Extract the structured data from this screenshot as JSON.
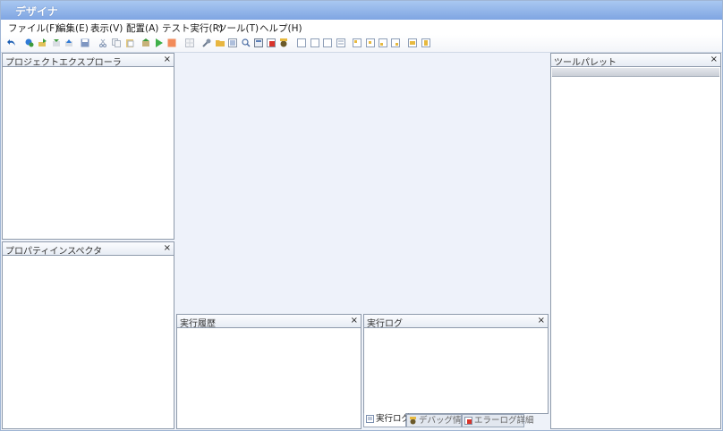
{
  "app": {
    "title": "デザイナ"
  },
  "menu": [
    {
      "label": "ファイル(F)"
    },
    {
      "label": "編集(E)"
    },
    {
      "label": "表示(V)"
    },
    {
      "label": "配置(A)"
    },
    {
      "label": "テスト実行(R)"
    },
    {
      "label": "ツール(T)"
    },
    {
      "label": "ヘルプ(H)"
    }
  ],
  "toolbar": {
    "icons": [
      "back-arrow-icon",
      "connect-icon",
      "refresh-icon",
      "import-icon",
      "export-icon",
      "save-icon",
      "cut-icon",
      "copy-icon",
      "paste-icon",
      "build-icon",
      "run-icon",
      "stop-icon",
      "grid-icon",
      "wrench-icon",
      "folder-icon",
      "list-icon",
      "search-icon",
      "properties-icon",
      "log-icon",
      "debug-icon",
      "align-left-icon",
      "align-center-icon",
      "align-right-icon",
      "align-justify-icon",
      "align-top-icon",
      "align-middle-icon",
      "align-bottom-icon",
      "distribute-icon",
      "size-width-icon",
      "size-height-icon"
    ]
  },
  "panels": {
    "project_explorer": {
      "title": "プロジェクトエクスプローラ",
      "close": "×"
    },
    "property_inspector": {
      "title": "プロパティインスペクタ",
      "close": "×"
    },
    "execution_history": {
      "title": "実行履歴",
      "close": "×"
    },
    "execution_log": {
      "title": "実行ログ",
      "close": "×"
    },
    "tool_palette": {
      "title": "ツールパレット",
      "close": "×"
    }
  },
  "log_tabs": [
    {
      "label": "実行ログ",
      "active": true
    },
    {
      "label": "デバッグ情報",
      "active": false
    },
    {
      "label": "エラーログ詳細",
      "active": false
    }
  ],
  "colors": {
    "title_gradient_top": "#a9c8f1",
    "title_gradient_bottom": "#7fa5e2",
    "canvas_bg": "#eef2fa",
    "panel_border": "#8e9aab"
  }
}
